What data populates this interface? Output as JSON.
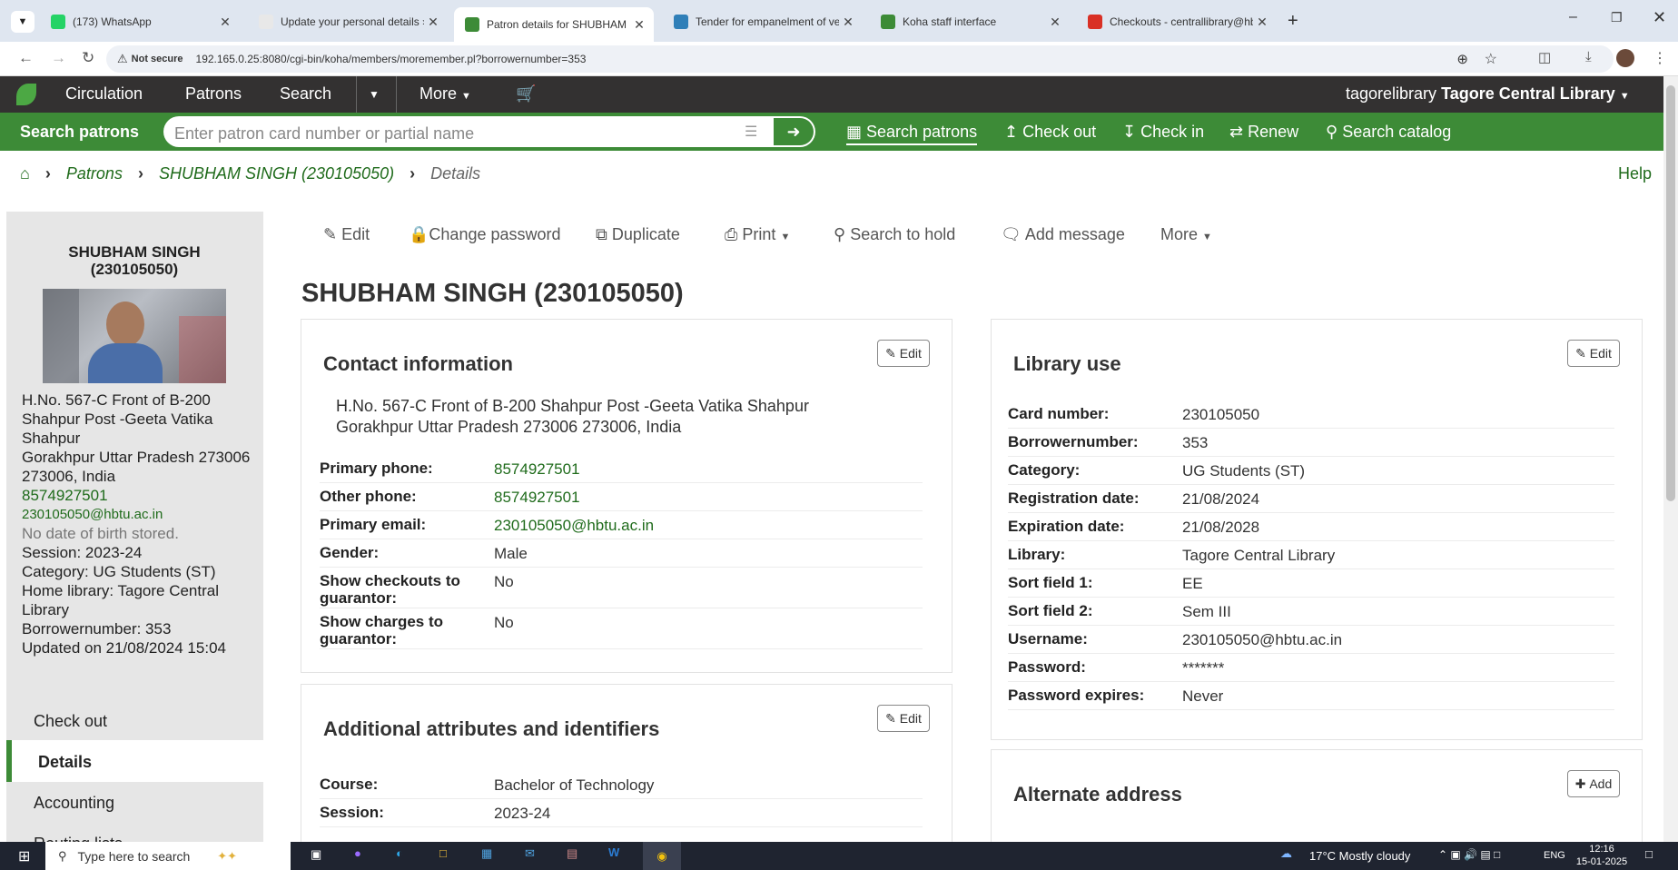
{
  "browser": {
    "tabs": [
      {
        "title": "(173) WhatsApp",
        "icon": "whatsapp-icon",
        "color": "#25d366"
      },
      {
        "title": "Update your personal details › K",
        "icon": "koha-icon",
        "color": "#e8e8e8"
      },
      {
        "title": "Patron details for SHUBHAM SI",
        "icon": "koha-icon",
        "color": "#3d8b37",
        "active": true
      },
      {
        "title": "Tender for empanelment of ven",
        "icon": "tender-icon",
        "color": "#2f7fb8"
      },
      {
        "title": "Koha staff interface",
        "icon": "koha-icon",
        "color": "#3d8b37"
      },
      {
        "title": "Checkouts - centrallibrary@hbt",
        "icon": "gmail-icon",
        "color": "#d93025"
      }
    ],
    "security_label": "Not secure",
    "url": "192.165.0.25:8080/cgi-bin/koha/members/moremember.pl?borrowernumber=353"
  },
  "nav": {
    "items": [
      "Circulation",
      "Patrons",
      "Search",
      "More"
    ],
    "user": "tagorelibrary",
    "library": "Tagore Central Library"
  },
  "searchbar": {
    "tab_label": "Search patrons",
    "placeholder": "Enter patron card number or partial name",
    "links": [
      "Search patrons",
      "Check out",
      "Check in",
      "Renew",
      "Search catalog"
    ]
  },
  "breadcrumb": {
    "patrons": "Patrons",
    "patron": "SHUBHAM SINGH (230105050)",
    "current": "Details",
    "help": "Help"
  },
  "sidebar": {
    "name_line1": "SHUBHAM SINGH",
    "name_line2": "(230105050)",
    "info": [
      {
        "text": "H.No. 567-C Front of B-200 Shahpur Post -Geeta Vatika Shahpur",
        "style": ""
      },
      {
        "text": "Gorakhpur Uttar Pradesh 273006 273006, India",
        "style": ""
      },
      {
        "text": "8574927501",
        "style": "g"
      },
      {
        "text": "230105050@hbtu.ac.in",
        "style": "g small"
      },
      {
        "text": "No date of birth stored.",
        "style": "muted"
      },
      {
        "text": "Session: 2023-24",
        "style": ""
      },
      {
        "text": "Category: UG Students (ST)",
        "style": ""
      },
      {
        "text": "Home library: Tagore Central Library",
        "style": ""
      },
      {
        "text": "Borrowernumber: 353",
        "style": ""
      },
      {
        "text": "Updated on 21/08/2024 15:04",
        "style": ""
      }
    ],
    "menu": [
      "Check out",
      "Details",
      "Accounting",
      "Routing lists"
    ]
  },
  "toolbar": {
    "edit": "Edit",
    "change_password": "Change password",
    "duplicate": "Duplicate",
    "print": "Print",
    "search_hold": "Search to hold",
    "add_message": "Add message",
    "more": "More"
  },
  "page_title": "SHUBHAM SINGH (230105050)",
  "contact": {
    "heading": "Contact information",
    "edit": "Edit",
    "address_line1": "H.No. 567-C Front of B-200 Shahpur Post -Geeta Vatika Shahpur",
    "address_line2": "Gorakhpur Uttar Pradesh 273006 273006, India",
    "rows": [
      {
        "label": "Primary phone:",
        "value": "8574927501",
        "link": true
      },
      {
        "label": "Other phone:",
        "value": "8574927501",
        "link": true
      },
      {
        "label": "Primary email:",
        "value": "230105050@hbtu.ac.in",
        "link": true
      },
      {
        "label": "Gender:",
        "value": "Male"
      },
      {
        "label": "Show checkouts to guarantor:",
        "value": "No"
      },
      {
        "label": "Show charges to guarantor:",
        "value": "No"
      }
    ]
  },
  "attributes": {
    "heading": "Additional attributes and identifiers",
    "edit": "Edit",
    "rows": [
      {
        "label": "Course:",
        "value": "Bachelor of Technology"
      },
      {
        "label": "Session:",
        "value": "2023-24"
      }
    ]
  },
  "library_use": {
    "heading": "Library use",
    "edit": "Edit",
    "rows": [
      {
        "label": "Card number:",
        "value": "230105050"
      },
      {
        "label": "Borrowernumber:",
        "value": "353"
      },
      {
        "label": "Category:",
        "value": "UG Students (ST)"
      },
      {
        "label": "Registration date:",
        "value": "21/08/2024"
      },
      {
        "label": "Expiration date:",
        "value": "21/08/2028"
      },
      {
        "label": "Library:",
        "value": "Tagore Central Library"
      },
      {
        "label": "Sort field 1:",
        "value": "EE"
      },
      {
        "label": "Sort field 2:",
        "value": "Sem III"
      },
      {
        "label": "Username:",
        "value": "230105050@hbtu.ac.in"
      },
      {
        "label": "Password:",
        "value": "*******"
      },
      {
        "label": "Password expires:",
        "value": "Never"
      }
    ]
  },
  "alternate": {
    "heading": "Alternate address",
    "add": "Add"
  },
  "taskbar": {
    "search_placeholder": "Type here to search",
    "weather": "17°C  Mostly cloudy",
    "lang": "ENG",
    "time": "12:16",
    "date": "15-01-2025"
  }
}
